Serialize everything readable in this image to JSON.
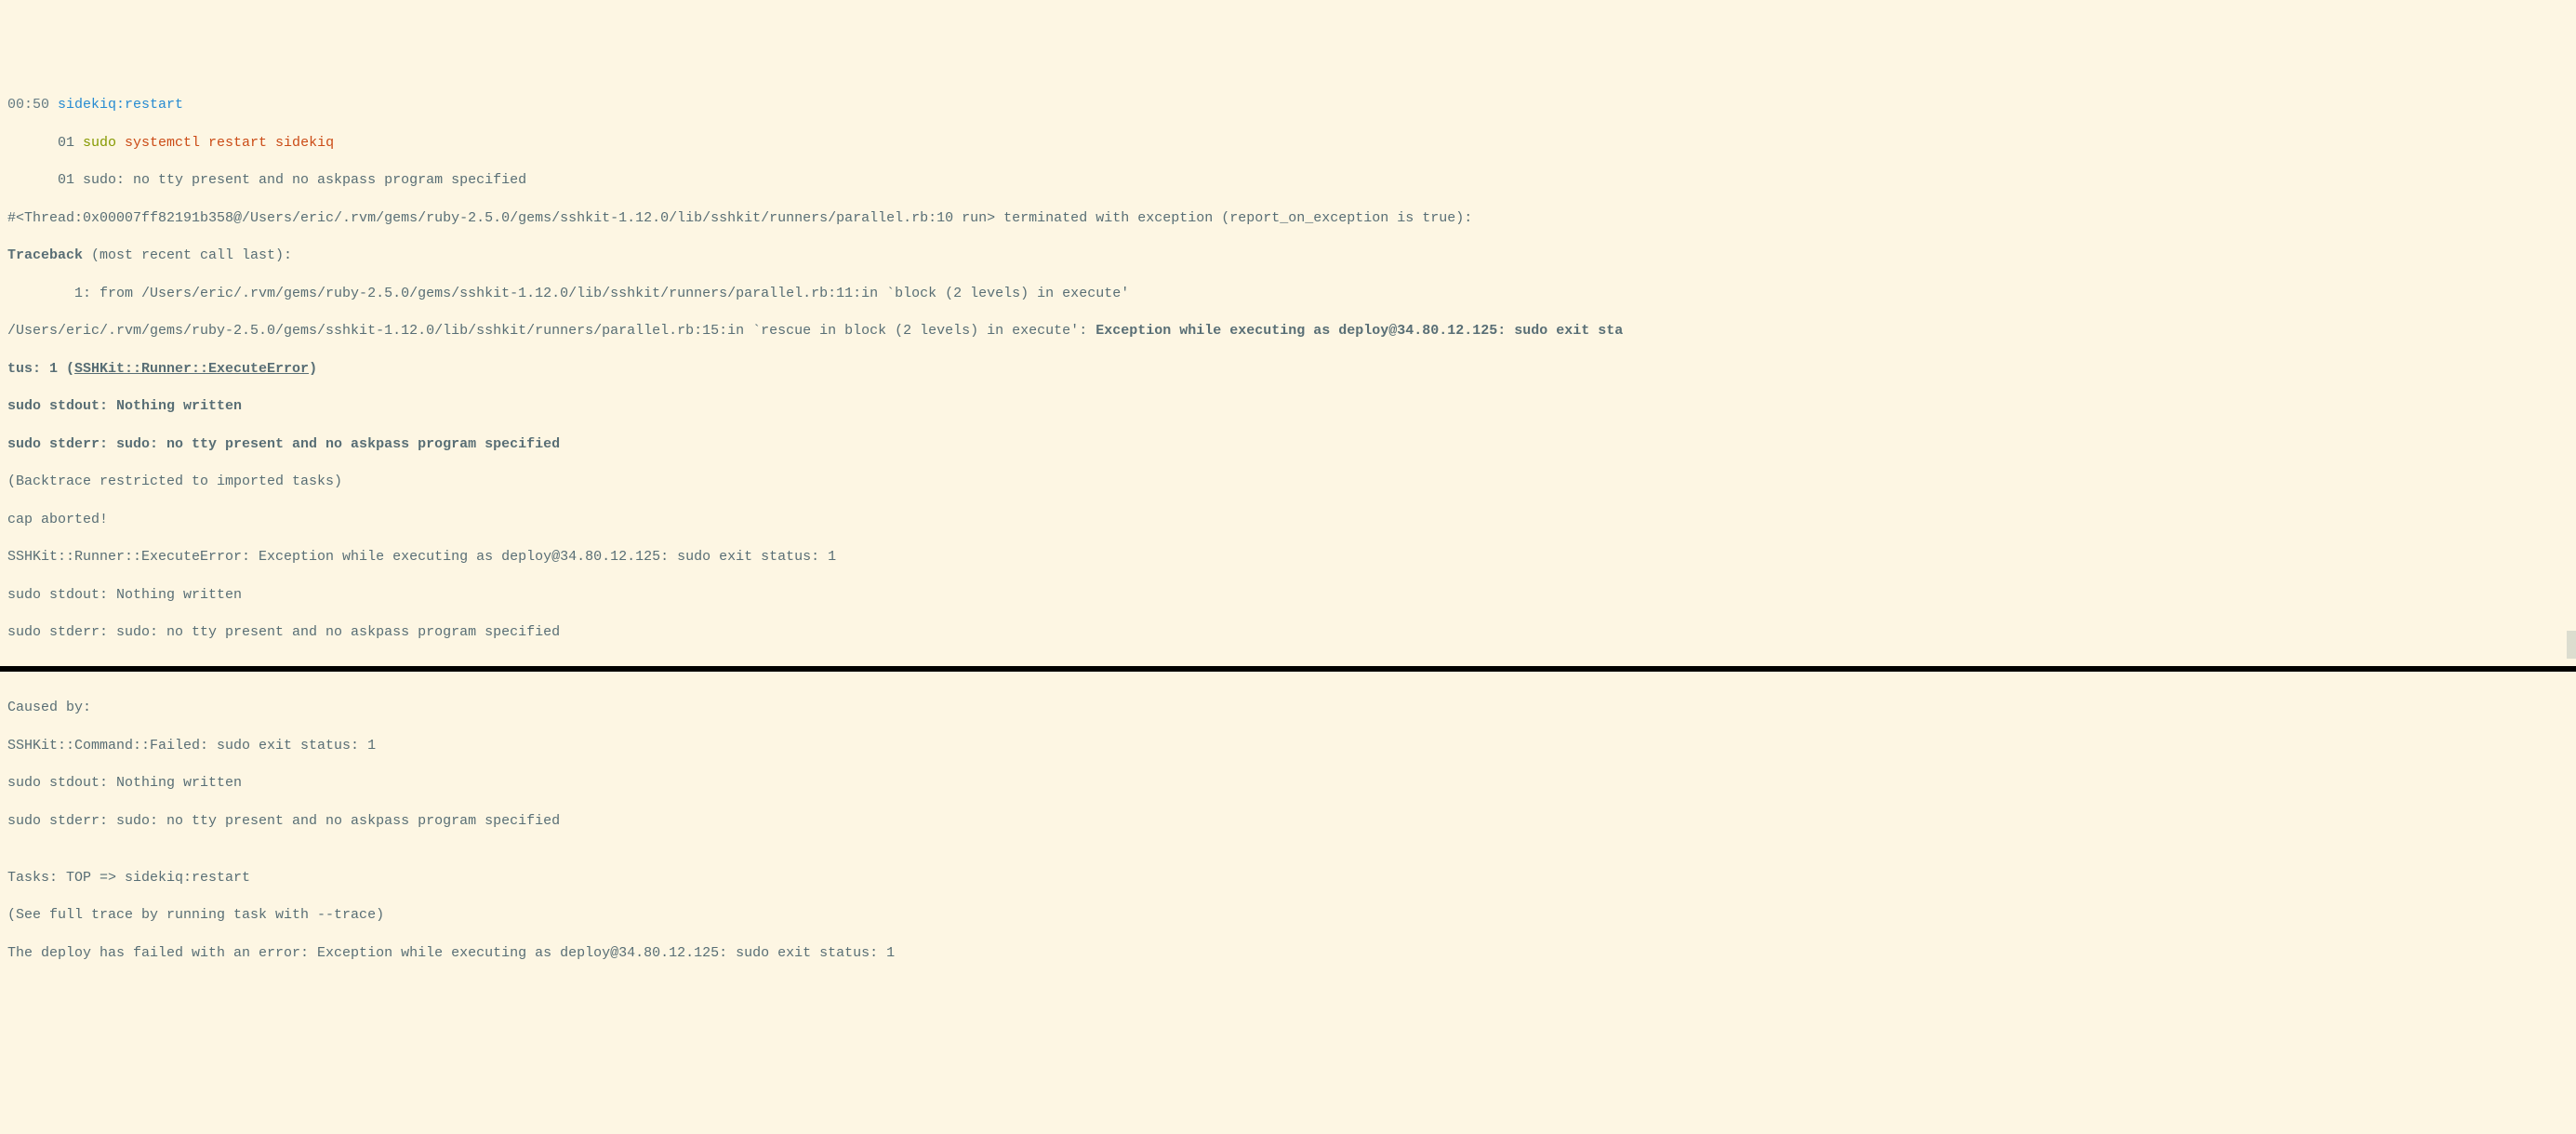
{
  "lines": {
    "l01_ts": "00:50",
    "l01_task": " sidekiq:restart",
    "l02_prefix": "      01 ",
    "l02_sudo": "sudo",
    "l02_systemctl": " systemctl restart sidekiq",
    "l03": "      01 sudo: no tty present and no askpass program specified",
    "l04": "#<Thread:0x00007ff82191b358@/Users/eric/.rvm/gems/ruby-2.5.0/gems/sshkit-1.12.0/lib/sshkit/runners/parallel.rb:10 run> terminated with exception (report_on_exception is true):",
    "l05_bold": "Traceback",
    "l05_rest": " (most recent call last):",
    "l06": "        1: from /Users/eric/.rvm/gems/ruby-2.5.0/gems/sshkit-1.12.0/lib/sshkit/runners/parallel.rb:11:in `block (2 levels) in execute'",
    "l07_a": "/Users/eric/.rvm/gems/ruby-2.5.0/gems/sshkit-1.12.0/lib/sshkit/runners/parallel.rb:15:in `rescue in block (2 levels) in execute': ",
    "l07_b": "Exception while executing as deploy@34.80.12.125: sudo exit sta",
    "l08_a": "tus: 1 (",
    "l08_b": "SSHKit::Runner::ExecuteError",
    "l08_c": ")",
    "l09": "sudo stdout: Nothing written",
    "l10": "sudo stderr: sudo: no tty present and no askpass program specified",
    "l11": "(Backtrace restricted to imported tasks)",
    "l12": "cap aborted!",
    "l13": "SSHKit::Runner::ExecuteError: Exception while executing as deploy@34.80.12.125: sudo exit status: 1",
    "l14": "sudo stdout: Nothing written",
    "l15": "sudo stderr: sudo: no tty present and no askpass program specified",
    "blank": "",
    "l17": "Caused by:",
    "l18": "SSHKit::Command::Failed: sudo exit status: 1",
    "l19": "sudo stdout: Nothing written",
    "l20": "sudo stderr: sudo: no tty present and no askpass program specified",
    "l22": "Tasks: TOP => sidekiq:restart",
    "l23": "(See full trace by running task with --trace)",
    "l24": "The deploy has failed with an error: Exception while executing as deploy@34.80.12.125: sudo exit status: 1"
  }
}
